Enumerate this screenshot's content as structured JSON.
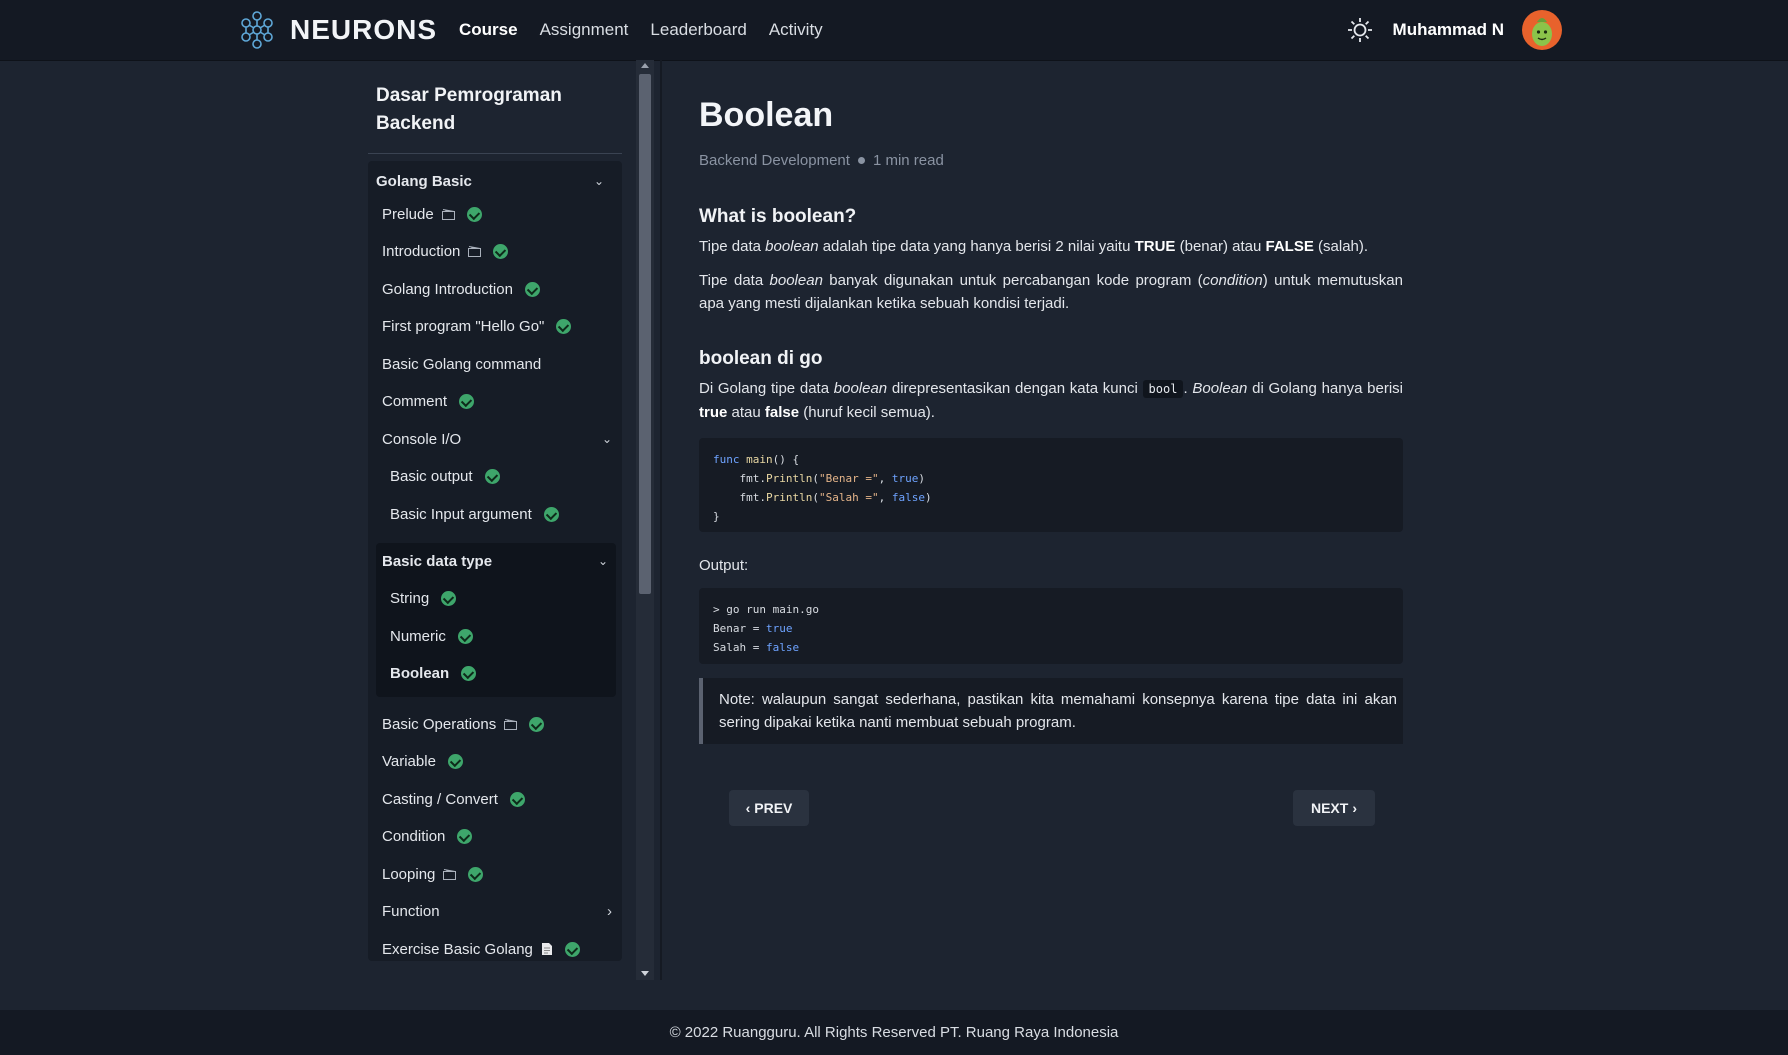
{
  "brand": {
    "name": "NEURONS"
  },
  "nav": {
    "links": [
      "Course",
      "Assignment",
      "Leaderboard",
      "Activity"
    ],
    "active": "Course"
  },
  "user": {
    "name": "Muhammad N"
  },
  "sidebar": {
    "course_title": "Dasar Pemrograman Backend",
    "module_title": "Golang Basic",
    "items": [
      {
        "label": "Prelude",
        "icon": "video-icon",
        "done": true
      },
      {
        "label": "Introduction",
        "icon": "video-icon",
        "done": true
      },
      {
        "label": "Golang Introduction",
        "done": true
      },
      {
        "label": "First program \"Hello Go\"",
        "done": true
      },
      {
        "label": "Basic Golang command",
        "done": false
      },
      {
        "label": "Comment",
        "done": true
      }
    ],
    "console_io": {
      "label": "Console I/O",
      "items": [
        {
          "label": "Basic output",
          "done": true
        },
        {
          "label": "Basic Input argument",
          "done": true
        }
      ]
    },
    "basic_data_type": {
      "label": "Basic data type",
      "items": [
        {
          "label": "String",
          "done": true
        },
        {
          "label": "Numeric",
          "done": true
        },
        {
          "label": "Boolean",
          "done": true,
          "active": true
        }
      ]
    },
    "items_after": [
      {
        "label": "Basic Operations",
        "icon": "video-icon",
        "done": true
      },
      {
        "label": "Variable",
        "done": true
      },
      {
        "label": "Casting / Convert",
        "done": true
      },
      {
        "label": "Condition",
        "done": true
      },
      {
        "label": "Looping",
        "icon": "video-icon",
        "done": true
      },
      {
        "label": "Function",
        "expandable": true
      },
      {
        "label": "Exercise Basic Golang",
        "icon": "document-icon",
        "done": true
      }
    ]
  },
  "article": {
    "title": "Boolean",
    "category": "Backend Development",
    "read_time": "1 min read",
    "section1": {
      "heading": "What is boolean?",
      "p1": [
        "Tipe data ",
        "boolean",
        " adalah tipe data yang hanya berisi 2 nilai yaitu ",
        "TRUE",
        " (benar) atau ",
        "FALSE",
        " (salah)."
      ],
      "p2": [
        "Tipe data ",
        "boolean",
        " banyak digunakan untuk percabangan kode program (",
        "condition",
        ") untuk memutuskan apa yang mesti dijalankan ketika sebuah kondisi terjadi."
      ]
    },
    "section2": {
      "heading": "boolean di go",
      "p1": [
        "Di Golang tipe data ",
        "boolean",
        " direpresentasikan dengan kata kunci ",
        "bool",
        ". ",
        "Boolean",
        " di Golang hanya berisi ",
        "true",
        " atau ",
        "false",
        " (huruf kecil semua)."
      ]
    },
    "code": {
      "line1": [
        "func",
        " ",
        "main",
        "() {"
      ],
      "line2": [
        "    fmt.",
        "Println",
        "(",
        "\"Benar =\"",
        ", ",
        "true",
        ")"
      ],
      "line3": [
        "    fmt.",
        "Println",
        "(",
        "\"Salah =\"",
        ", ",
        "false",
        ")"
      ],
      "line4": "}"
    },
    "output_label": "Output:",
    "output": {
      "line1": "> go run main.go",
      "line2": [
        "Benar = ",
        "true"
      ],
      "line3": [
        "Salah = ",
        "false"
      ]
    },
    "note": "Note: walaupun sangat sederhana, pastikan kita memahami konsepnya karena tipe data ini akan sering dipakai ketika nanti membuat sebuah program."
  },
  "pager": {
    "prev": "PREV",
    "next": "NEXT"
  },
  "footer": {
    "text": "© 2022 Ruangguru. All Rights Reserved PT. Ruang Raya Indonesia"
  },
  "colors": {
    "background": "#1d2430",
    "nav": "#141923",
    "check": "#3ea66b",
    "avatar": "#e8622c"
  }
}
